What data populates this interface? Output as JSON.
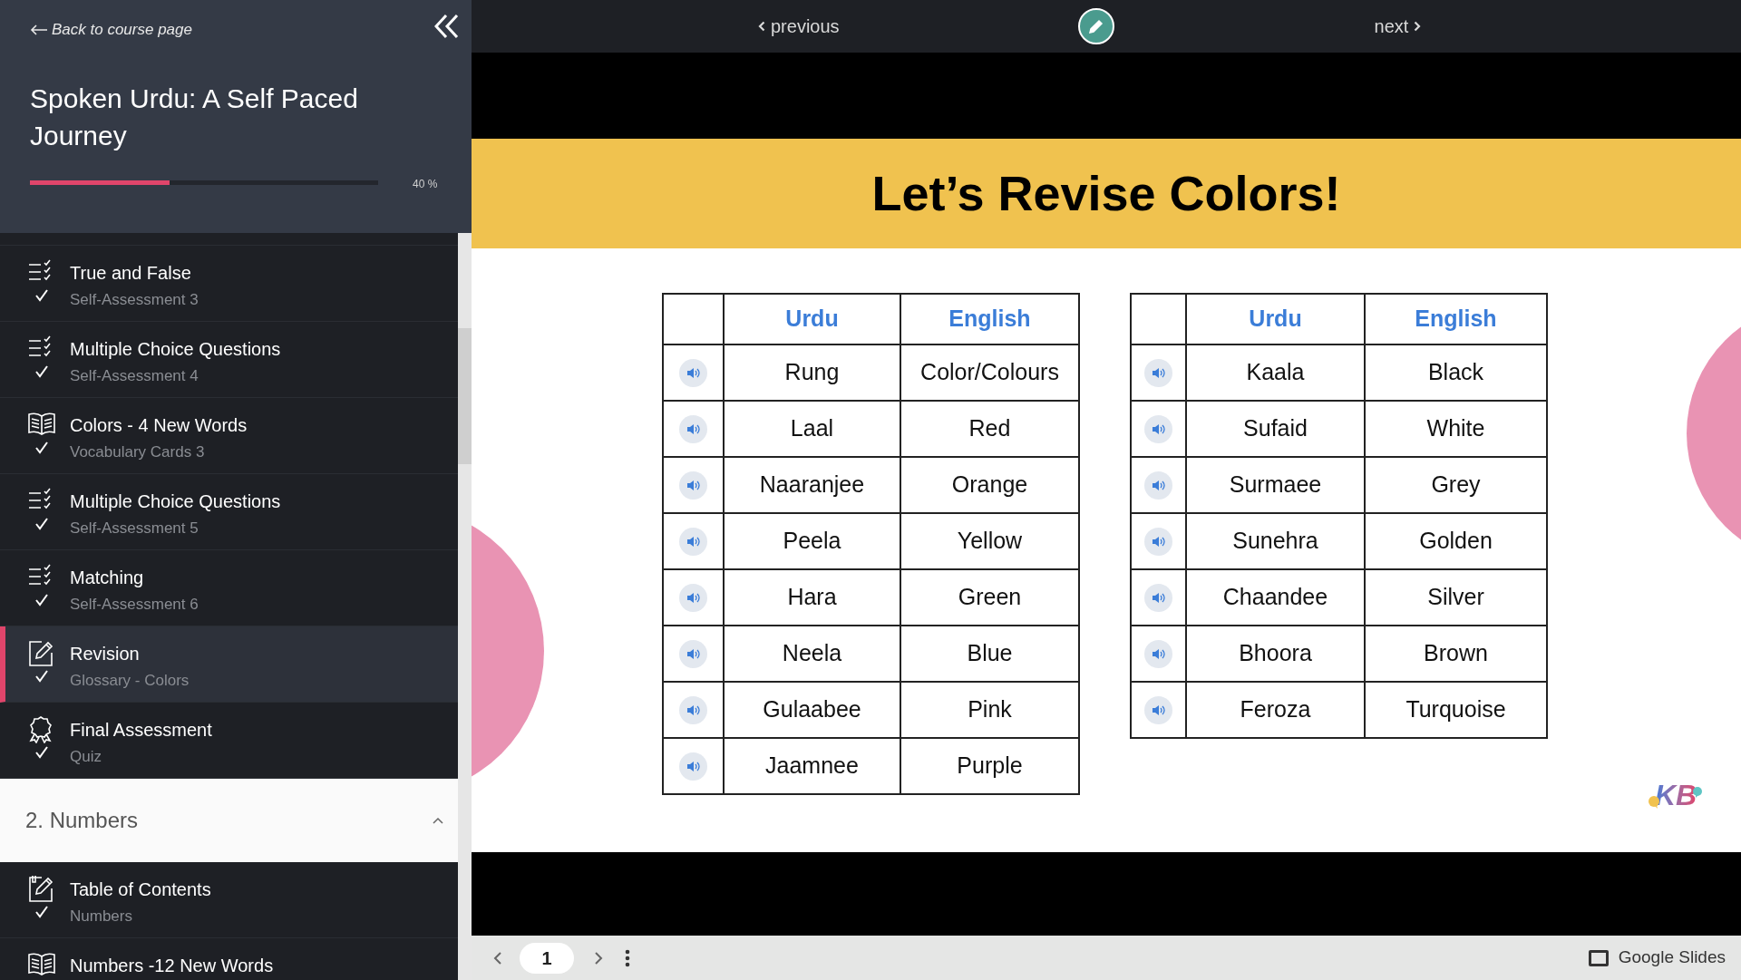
{
  "sidebar": {
    "back_link": "Back to course page",
    "course_title": "Spoken Urdu: A Self Paced Journey",
    "progress": {
      "level": 0.4,
      "label": "40 %"
    },
    "lessons": [
      {
        "kind": "quiz",
        "title": "True and False",
        "subtitle": "Self-Assessment 3",
        "completed": true,
        "selected": false
      },
      {
        "kind": "quiz",
        "title": "Multiple Choice Questions",
        "subtitle": "Self-Assessment 4",
        "completed": true,
        "selected": false
      },
      {
        "kind": "vocab",
        "title": "Colors - 4 New Words",
        "subtitle": "Vocabulary Cards 3",
        "completed": true,
        "selected": false
      },
      {
        "kind": "quiz",
        "title": "Multiple Choice Questions",
        "subtitle": "Self-Assessment 5",
        "completed": true,
        "selected": false
      },
      {
        "kind": "quiz",
        "title": "Matching",
        "subtitle": "Self-Assessment 6",
        "completed": true,
        "selected": false
      },
      {
        "kind": "edit",
        "title": "Revision",
        "subtitle": "Glossary - Colors",
        "completed": true,
        "selected": true
      },
      {
        "kind": "award",
        "title": "Final Assessment",
        "subtitle": "Quiz",
        "completed": true,
        "selected": false
      }
    ],
    "next_section": {
      "title": "2. Numbers",
      "expanded": true,
      "lessons": [
        {
          "kind": "notes",
          "title": "Table of Contents",
          "subtitle": "Numbers",
          "completed": true,
          "selected": false
        },
        {
          "kind": "vocab",
          "title": "Numbers -12 New Words",
          "selected": false
        }
      ]
    }
  },
  "top_nav": {
    "previous": "previous",
    "next": "next"
  },
  "slide": {
    "title": "Let’s Revise Colors!",
    "logo_text": "KB",
    "tables": [
      {
        "columns": [
          "Urdu",
          "English"
        ],
        "rows": [
          [
            "Rung",
            "Color/Colours"
          ],
          [
            "Laal",
            "Red"
          ],
          [
            "Naaranjee",
            "Orange"
          ],
          [
            "Peela",
            "Yellow"
          ],
          [
            "Hara",
            "Green"
          ],
          [
            "Neela",
            "Blue"
          ],
          [
            "Gulaabee",
            "Pink"
          ],
          [
            "Jaamnee",
            "Purple"
          ]
        ]
      },
      {
        "columns": [
          "Urdu",
          "English"
        ],
        "rows": [
          [
            "Kaala",
            "Black"
          ],
          [
            "Sufaid",
            "White"
          ],
          [
            "Surmaee",
            "Grey"
          ],
          [
            "Sunehra",
            "Golden"
          ],
          [
            "Chaandee",
            "Silver"
          ],
          [
            "Bhoora",
            "Brown"
          ],
          [
            "Feroza",
            "Turquoise"
          ]
        ]
      }
    ]
  },
  "slides_bar": {
    "page": "1",
    "app": "Google Slides"
  }
}
